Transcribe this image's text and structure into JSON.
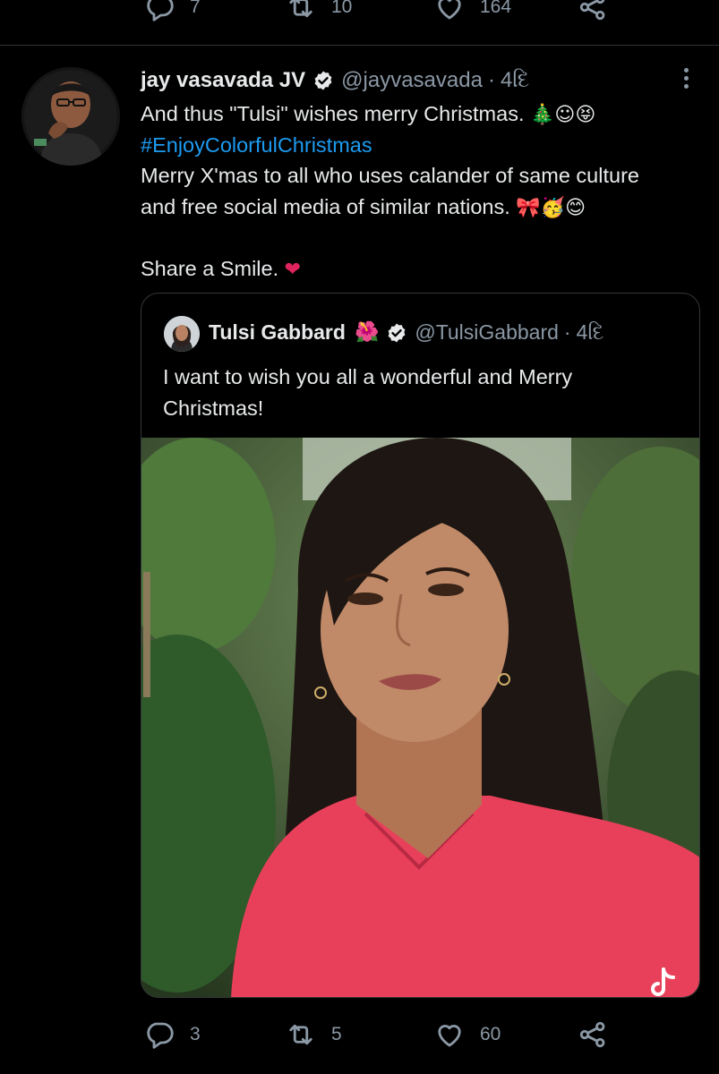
{
  "top_actions": {
    "replies": "7",
    "retweets": "10",
    "likes": "164"
  },
  "tweet": {
    "author_name": "jay vasavada JV",
    "handle": "@jayvasavada",
    "separator": "·",
    "time": "4દિ",
    "text_line1": "And thus \"Tulsi\" wishes merry Christmas.",
    "text_line1_emoji": "🎄☺😝",
    "hashtag": "#EnjoyColorfulChristmas",
    "text_line3": "Merry X'mas to all who uses calander of same culture",
    "text_line4": "and free social media of similar nations.",
    "text_line4_emoji": "🎀🥳😊",
    "text_line6": "Share a Smile.",
    "text_line6_emoji": "❤"
  },
  "quoted_tweet": {
    "author_name": "Tulsi Gabbard",
    "name_emoji": "🌺",
    "handle": "@TulsiGabbard",
    "separator": "·",
    "time": "4દિ",
    "text": "I want to wish you all a wonderful and Merry Christmas!"
  },
  "bottom_actions": {
    "replies": "3",
    "retweets": "5",
    "likes": "60"
  },
  "colors": {
    "background": "#000000",
    "text": "#e7e9ea",
    "muted": "#8b98a5",
    "link": "#1d9bf0",
    "heart_emoji": "#e0245e",
    "shirt": "#e8405a"
  },
  "icons": [
    "reply-icon",
    "retweet-icon",
    "like-icon",
    "share-icon",
    "verified-badge-icon",
    "more-options-icon",
    "tiktok-logo-icon"
  ]
}
